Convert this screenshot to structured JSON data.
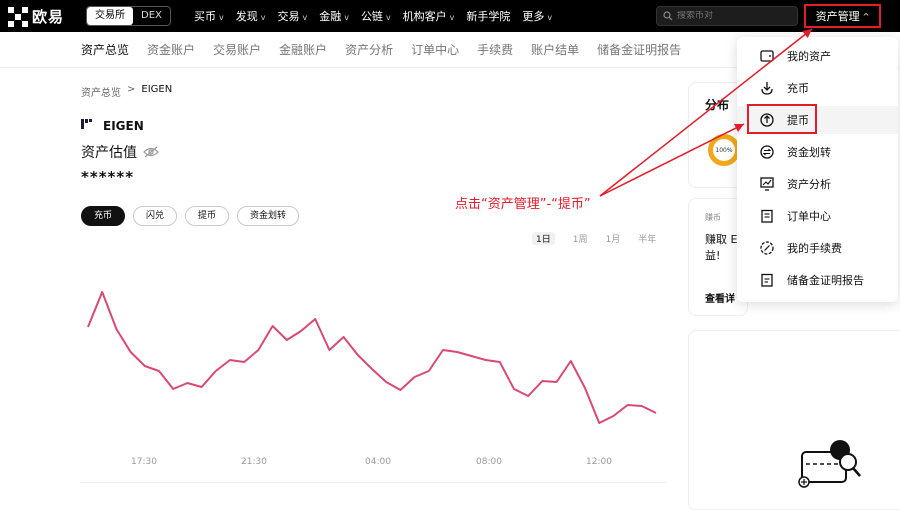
{
  "topbar": {
    "logo_text": "欧易",
    "mode_tabs": [
      "交易所",
      "DEX"
    ],
    "nav": [
      "买币",
      "发现",
      "交易",
      "金融",
      "公链",
      "机构客户",
      "新手学院",
      "更多"
    ],
    "nav_has_chevron": [
      true,
      true,
      true,
      true,
      true,
      true,
      false,
      true
    ],
    "search_placeholder": "搜索币对",
    "asset_management": "资产管理"
  },
  "subnav": [
    "资产总览",
    "资金账户",
    "交易账户",
    "金融账户",
    "资产分析",
    "订单中心",
    "手续费",
    "账户结单",
    "储备金证明报告"
  ],
  "breadcrumb": {
    "parent": "资产总览",
    "sep": ">",
    "current": "EIGEN"
  },
  "coin": {
    "logo_glyph": "E'",
    "name": "EIGEN"
  },
  "valuation_label": "资产估值",
  "masked_balance": "******",
  "actions": [
    "充币",
    "闪兑",
    "提币",
    "资金划转"
  ],
  "annotation": "点击“资产管理”-“提币”",
  "periods": [
    "1日",
    "1周",
    "1月",
    "半年"
  ],
  "chart_data": {
    "type": "line",
    "x_labels": [
      "17:30",
      "21:30",
      "04:00",
      "08:00",
      "12:00"
    ],
    "values": [
      327,
      292,
      329,
      352,
      366,
      371,
      389,
      383,
      387,
      371,
      360,
      362,
      350,
      326,
      340,
      331,
      319,
      350,
      337,
      355,
      369,
      382,
      390,
      377,
      371,
      350,
      352,
      356,
      360,
      362,
      389,
      396,
      381,
      382,
      361,
      388,
      423,
      416,
      405,
      406,
      413
    ],
    "color": "#d94a72"
  },
  "distribution": {
    "title": "分布",
    "donut_label": "100%"
  },
  "earn": {
    "tag": "赚币",
    "text": "赚取 E\n益!",
    "more": "查看详"
  },
  "dropdown": [
    {
      "label": "我的资产",
      "icon": "wallet-icon"
    },
    {
      "label": "充币",
      "icon": "deposit-icon"
    },
    {
      "label": "提币",
      "icon": "withdraw-icon"
    },
    {
      "label": "资金划转",
      "icon": "transfer-icon"
    },
    {
      "label": "资产分析",
      "icon": "analysis-icon"
    },
    {
      "label": "订单中心",
      "icon": "orders-icon"
    },
    {
      "label": "我的手续费",
      "icon": "fee-icon"
    },
    {
      "label": "储备金证明报告",
      "icon": "reserve-icon"
    }
  ],
  "colors": {
    "accent_red": "#e21c2a",
    "chart_line": "#d94a72",
    "donut": "#f0a81a"
  }
}
